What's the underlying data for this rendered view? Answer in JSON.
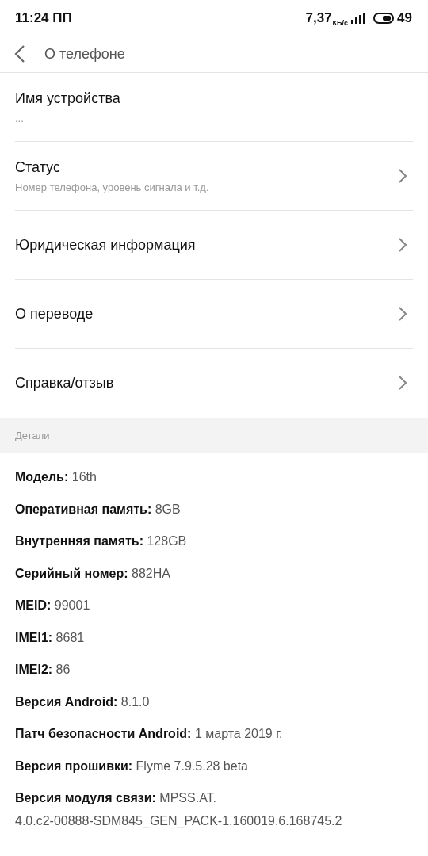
{
  "status_bar": {
    "time": "11:24 ПП",
    "net_speed": "7,37",
    "net_unit": "КБ/с",
    "battery": "49"
  },
  "header": {
    "title": "О телефоне"
  },
  "settings": [
    {
      "title": "Имя устройства",
      "subtitle": "...",
      "has_arrow": false
    },
    {
      "title": "Статус",
      "subtitle": "Номер телефона, уровень сигнала и т.д.",
      "has_arrow": true
    },
    {
      "title": "Юридическая информация",
      "has_arrow": true
    },
    {
      "title": "О переводе",
      "has_arrow": true
    },
    {
      "title": "Справка/отзыв",
      "has_arrow": true
    }
  ],
  "details": {
    "heading": "Детали",
    "items": [
      {
        "label": "Модель:",
        "value": "16th"
      },
      {
        "label": "Оперативная память:",
        "value": "8GB"
      },
      {
        "label": "Внутренняя память:",
        "value": "128GB"
      },
      {
        "label": "Серийный номер:",
        "value": "882HA"
      },
      {
        "label": "MEID:",
        "value": "99001"
      },
      {
        "label": "IMEI1:",
        "value": "8681"
      },
      {
        "label": "IMEI2:",
        "value": "86"
      },
      {
        "label": "Версия Android:",
        "value": "8.1.0"
      },
      {
        "label": "Патч безопасности Android:",
        "value": "1 марта 2019 г."
      },
      {
        "label": "Версия прошивки:",
        "value": "Flyme 7.9.5.28 beta"
      },
      {
        "label": "Версия модуля связи:",
        "value": "MPSS.AT.",
        "value_continued": "4.0.c2-00888-SDM845_GEN_PACK-1.160019.6.168745.2"
      }
    ]
  }
}
